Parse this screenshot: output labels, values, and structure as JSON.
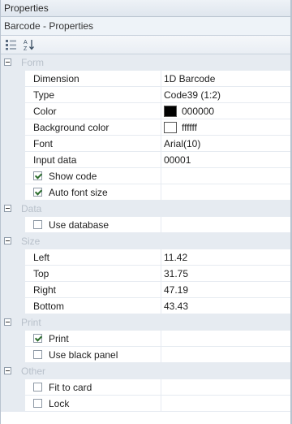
{
  "window": {
    "title": "Properties"
  },
  "object_selector": {
    "value": "Barcode - Properties"
  },
  "toolbar": {
    "categorized_icon": "categorized-icon",
    "alphabetical_icon": "sort-az-icon"
  },
  "grid": {
    "form": {
      "label": "Form",
      "dimension": {
        "name": "Dimension",
        "value": "1D Barcode"
      },
      "type": {
        "name": "Type",
        "value": "Code39 (1:2)"
      },
      "color": {
        "name": "Color",
        "value": "000000",
        "swatch": "#000000"
      },
      "background_color": {
        "name": "Background color",
        "value": "ffffff",
        "swatch": "#ffffff"
      },
      "font": {
        "name": "Font",
        "value": "Arial(10)"
      },
      "input_data": {
        "name": "Input data",
        "value": "00001"
      },
      "show_code": {
        "name": "Show code",
        "checked": true
      },
      "auto_font_size": {
        "name": "Auto font size",
        "checked": true
      }
    },
    "data": {
      "label": "Data",
      "use_database": {
        "name": "Use database",
        "checked": false
      }
    },
    "size": {
      "label": "Size",
      "left": {
        "name": "Left",
        "value": "11.42"
      },
      "top": {
        "name": "Top",
        "value": "31.75"
      },
      "right": {
        "name": "Right",
        "value": "47.19"
      },
      "bottom": {
        "name": "Bottom",
        "value": "43.43"
      }
    },
    "print": {
      "label": "Print",
      "print": {
        "name": "Print",
        "checked": true
      },
      "use_black_panel": {
        "name": "Use black panel",
        "checked": false
      }
    },
    "other": {
      "label": "Other",
      "fit_to_card": {
        "name": "Fit to card",
        "checked": false
      },
      "lock": {
        "name": "Lock",
        "checked": false
      }
    }
  }
}
